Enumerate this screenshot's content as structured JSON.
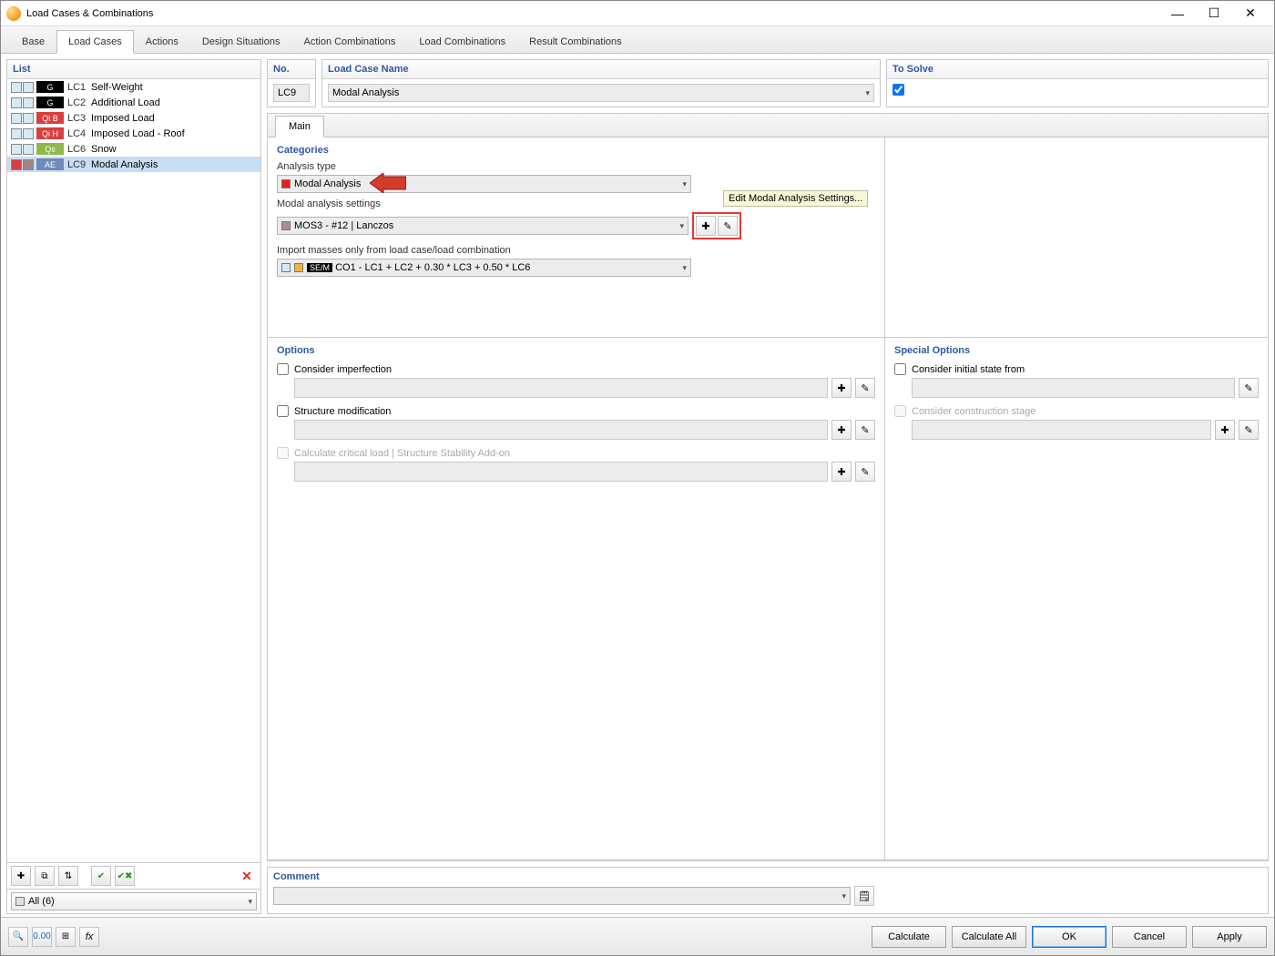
{
  "window": {
    "title": "Load Cases & Combinations"
  },
  "tabs": [
    "Base",
    "Load Cases",
    "Actions",
    "Design Situations",
    "Action Combinations",
    "Load Combinations",
    "Result Combinations"
  ],
  "active_tab": 1,
  "sidebar": {
    "header": "List",
    "items": [
      {
        "sw1": "#d5eaf2",
        "sw2": "#d5eaf2",
        "tag": "G",
        "tagbg": "#000000",
        "id": "LC1",
        "name": "Self-Weight"
      },
      {
        "sw1": "#d5eaf2",
        "sw2": "#d5eaf2",
        "tag": "G",
        "tagbg": "#000000",
        "id": "LC2",
        "name": "Additional Load"
      },
      {
        "sw1": "#d5eaf2",
        "sw2": "#d5eaf2",
        "tag": "Qi B",
        "tagbg": "#d93f3f",
        "id": "LC3",
        "name": "Imposed Load"
      },
      {
        "sw1": "#d5eaf2",
        "sw2": "#d5eaf2",
        "tag": "Qi H",
        "tagbg": "#d93f3f",
        "id": "LC4",
        "name": "Imposed Load - Roof"
      },
      {
        "sw1": "#d5eaf2",
        "sw2": "#d5eaf2",
        "tag": "Qs",
        "tagbg": "#8fb84a",
        "id": "LC6",
        "name": "Snow"
      },
      {
        "sw1": "#d93f3f",
        "sw2": "#a08787",
        "tag": "AE",
        "tagbg": "#6f89b8",
        "id": "LC9",
        "name": "Modal Analysis"
      }
    ],
    "selected_index": 5,
    "filter": {
      "swatch": "#e0e0e0",
      "text": "All (6)"
    }
  },
  "top": {
    "no_header": "No.",
    "no_value": "LC9",
    "name_header": "Load Case Name",
    "name_value": "Modal Analysis",
    "solve_header": "To Solve",
    "solve_checked": true
  },
  "sub_tabs": {
    "main": "Main"
  },
  "categories": {
    "title": "Categories",
    "analysis_type_label": "Analysis type",
    "analysis_type_value": "Modal Analysis",
    "analysis_type_swatch": "#e41f1f",
    "modal_settings_label": "Modal analysis settings",
    "modal_settings_value": "MOS3 - #12 | Lanczos",
    "modal_settings_swatch": "#b08d8d",
    "tooltip": "Edit Modal Analysis Settings...",
    "import_label": "Import masses only from load case/load combination",
    "import_swatch1": "#d5eaf2",
    "import_swatch2": "#f0b43c",
    "import_tag": "SE/M",
    "import_value": "CO1 - LC1 + LC2 + 0.30 * LC3 + 0.50 * LC6"
  },
  "options": {
    "title": "Options",
    "consider_imperfection": "Consider imperfection",
    "structure_modification": "Structure modification",
    "critical_load": "Calculate critical load | Structure Stability Add-on"
  },
  "special": {
    "title": "Special Options",
    "initial_state": "Consider initial state from",
    "construction_stage": "Consider construction stage"
  },
  "comment": {
    "title": "Comment"
  },
  "footer": {
    "calculate": "Calculate",
    "calculate_all": "Calculate All",
    "ok": "OK",
    "cancel": "Cancel",
    "apply": "Apply"
  }
}
